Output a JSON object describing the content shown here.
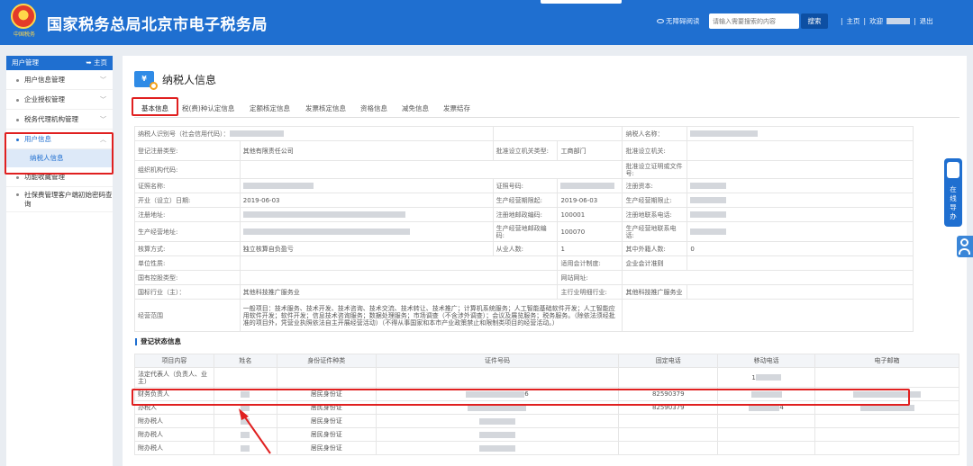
{
  "header": {
    "title": "国家税务总局北京市电子税务局",
    "emblem_text": "中国税务",
    "accessible_label": "无障碍阅读",
    "search_placeholder": "请输入需要搜索的内容",
    "search_button": "搜索",
    "home_link": "主页",
    "welcome_label": "欢迎",
    "logout_link": "退出",
    "separator": "|"
  },
  "sidebar": {
    "title": "用户管理",
    "home_label": "主页",
    "items": [
      {
        "label": "用户信息管理"
      },
      {
        "label": "企业授权管理"
      },
      {
        "label": "税务代理机构管理"
      },
      {
        "label": "用户信息"
      },
      {
        "label": "纳税人信息"
      },
      {
        "label": "功能收藏管理"
      },
      {
        "label": "社保费管理客户端初始密码查询"
      }
    ]
  },
  "main": {
    "title": "纳税人信息",
    "icon_text": "¥",
    "tabs": [
      {
        "label": "基本信息"
      },
      {
        "label": "税(费)种认定信息"
      },
      {
        "label": "定额核定信息"
      },
      {
        "label": "发票核定信息"
      },
      {
        "label": "资格信息"
      },
      {
        "label": "减免信息"
      },
      {
        "label": "发票结存"
      }
    ],
    "info": {
      "taxpayer_id_label": "纳税人识别号（社会信用代码）：",
      "taxpayer_name_label": "纳税人名称：",
      "reg_type_label": "登记注册类型:",
      "reg_type_value": "其他有限责任公司",
      "approval_org_label": "批准设立机关类型:",
      "approval_org_value": "工商部门",
      "approval_authority_label": "批准设立机关:",
      "org_code_label": "组织机构代码:",
      "approval_doc_label": "批准设立证明或文件号:",
      "cert_name_label": "证照名称:",
      "cert_no_label": "证照号码:",
      "reg_capital_label": "注册资本:",
      "open_date_label": "开业（设立）日期:",
      "open_date_value": "2019-06-03",
      "op_start_label": "生产经营期限起:",
      "op_start_value": "2019-06-03",
      "op_end_label": "生产经营期限止:",
      "reg_addr_label": "注册地址:",
      "reg_postcode_label": "注册地邮政编码:",
      "reg_postcode_value": "100001",
      "reg_phone_label": "注册地联系电话:",
      "op_addr_label": "生产经营地址:",
      "op_postcode_label": "生产经营地邮政编码:",
      "op_postcode_value": "100070",
      "op_phone_label": "生产经营地联系电话:",
      "accounting_label": "核算方式:",
      "accounting_value": "独立核算自负盈亏",
      "staff_label": "从业人数:",
      "staff_value": "1",
      "foreign_staff_label": "其中外籍人数:",
      "foreign_staff_value": "0",
      "unit_nature_label": "单位性质:",
      "accounting_system_label": "适用会计制度:",
      "accounting_system_value": "企业会计准则",
      "holding_label": "国有控股类型:",
      "website_label": "网站网址:",
      "industry_label": "国标行业（主）：",
      "industry_value": "其他科技推广服务业",
      "main_industry_label": "主行业明细行业:",
      "main_industry_value": "其他科技推广服务业",
      "scope_label": "经营范围",
      "scope_value": "一般项目：技术服务、技术开发、技术咨询、技术交流、技术转让、技术推广；计算机系统服务；人工智能基础软件开发；人工智能应用软件开发；软件开发；信息技术咨询服务；数据处理服务；市场调查（不含涉外调查）；会议及展览服务；税务服务。（除依法须经批准的项目外，凭营业执照依法自主开展经营活动）（不得从事国家和本市产业政策禁止和限制类项目的经营活动。）"
    },
    "registration_section": {
      "title": "登记状态信息",
      "columns": [
        "项目内容",
        "姓名",
        "身份证件种类",
        "证件号码",
        "固定电话",
        "移动电话",
        "电子邮箱"
      ],
      "rows": [
        {
          "role": "法定代表人（负责人、业主）",
          "id_type": "",
          "phone": "",
          "mobile_suffix": "1"
        },
        {
          "role": "财务负责人",
          "id_type": "居民身份证",
          "phone": "82590379",
          "id_suffix": "6",
          "mobile_suffix": ""
        },
        {
          "role": "办税人",
          "id_type": "居民身份证",
          "phone": "82590379",
          "id_suffix": "",
          "mobile_suffix": "4"
        },
        {
          "role": "附办税人",
          "id_type": "居民身份证",
          "phone": "",
          "mobile_suffix": ""
        },
        {
          "role": "附办税人",
          "id_type": "居民身份证",
          "phone": "",
          "mobile_suffix": ""
        },
        {
          "role": "附办税人",
          "id_type": "居民身份证",
          "phone": "",
          "mobile_suffix": ""
        }
      ]
    }
  },
  "floating": {
    "guide_label": "在线导办"
  },
  "colors": {
    "primary": "#1f6fd0",
    "highlight": "#e02020",
    "active_sub_bg": "#dde9f8"
  }
}
